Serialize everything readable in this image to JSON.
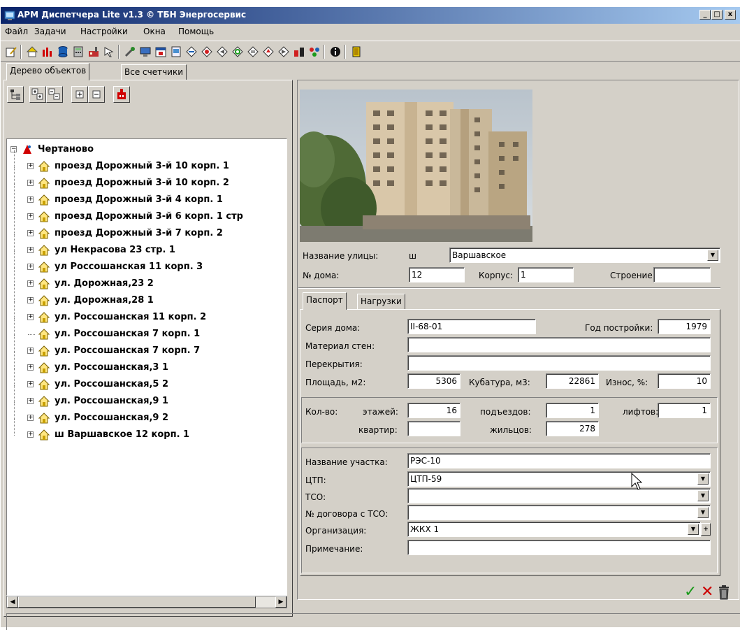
{
  "window": {
    "title": "АРМ Диспетчера Lite v1.3 © ТБН Энергосервис",
    "min_glyph": "_",
    "max_glyph": "□",
    "close_glyph": "x"
  },
  "menu": [
    "Файл",
    "Задачи",
    "Настройки",
    "Окна",
    "Помощь"
  ],
  "left_tabs": [
    "Дерево объектов",
    "Все счетчики"
  ],
  "tree": {
    "root": "Чертаново",
    "items": [
      "проезд Дорожный 3-й 10 корп. 1",
      "проезд Дорожный 3-й 10 корп. 2",
      "проезд Дорожный 3-й 4 корп. 1",
      "проезд Дорожный 3-й 6 корп. 1 стр",
      "проезд Дорожный 3-й 7 корп. 2",
      "ул Некрасова 23 стр. 1",
      "ул Россошанская 11 корп. 3",
      "ул. Дорожная,23 2",
      "ул. Дорожная,28 1",
      "ул. Россошанская 11 корп. 2",
      "ул. Россошанская 7 корп. 1",
      "ул. Россошанская 7 корп. 7",
      "ул. Россошанская,3 1",
      "ул. Россошанская,5 2",
      "ул. Россошанская,9 1",
      "ул. Россошанская,9 2",
      "ш Варшавское 12 корп. 1"
    ]
  },
  "address": {
    "street_label": "Название улицы:",
    "street_type": "ш",
    "street_name": "Варшавское",
    "house_label": "№ дома:",
    "house_value": "12",
    "korpus_label": "Корпус:",
    "korpus_value": "1",
    "stroenie_label": "Строение:",
    "stroenie_value": ""
  },
  "right_tabs": [
    "Паспорт",
    "Нагрузки"
  ],
  "passport": {
    "seria_label": "Серия дома:",
    "seria_value": "II-68-01",
    "year_label": "Год постройки:",
    "year_value": "1979",
    "material_label": "Материал стен:",
    "material_value": "",
    "perekr_label": "Перекрытия:",
    "perekr_value": "",
    "area_label": "Площадь, м2:",
    "area_value": "5306",
    "kub_label": "Кубатура, м3:",
    "kub_value": "22861",
    "iznos_label": "Износ, %:",
    "iznos_value": "10"
  },
  "counts": {
    "kolvo_label": "Кол-во:",
    "floors_label": "этажей:",
    "floors_value": "16",
    "entr_label": "подъездов:",
    "entr_value": "1",
    "lifts_label": "лифтов:",
    "lifts_value": "1",
    "flats_label": "квартир:",
    "flats_value": "",
    "resid_label": "жильцов:",
    "resid_value": "278"
  },
  "org": {
    "uch_label": "Название участка:",
    "uch_value": "РЭС-10",
    "ctp_label": "ЦТП:",
    "ctp_value": "ЦТП-59",
    "tso_label": "ТСО:",
    "tso_value": "",
    "dog_label": "№ договора с ТСО:",
    "dog_value": "",
    "org_label": "Организация:",
    "org_value": "ЖКХ 1",
    "prim_label": "Примечание:",
    "prim_value": ""
  },
  "actions": {
    "ok_glyph": "✓",
    "cancel_glyph": "✕",
    "delete_glyph": "🗑"
  },
  "colors": {
    "ok": "#1a9a1a",
    "cancel": "#cc0000"
  }
}
